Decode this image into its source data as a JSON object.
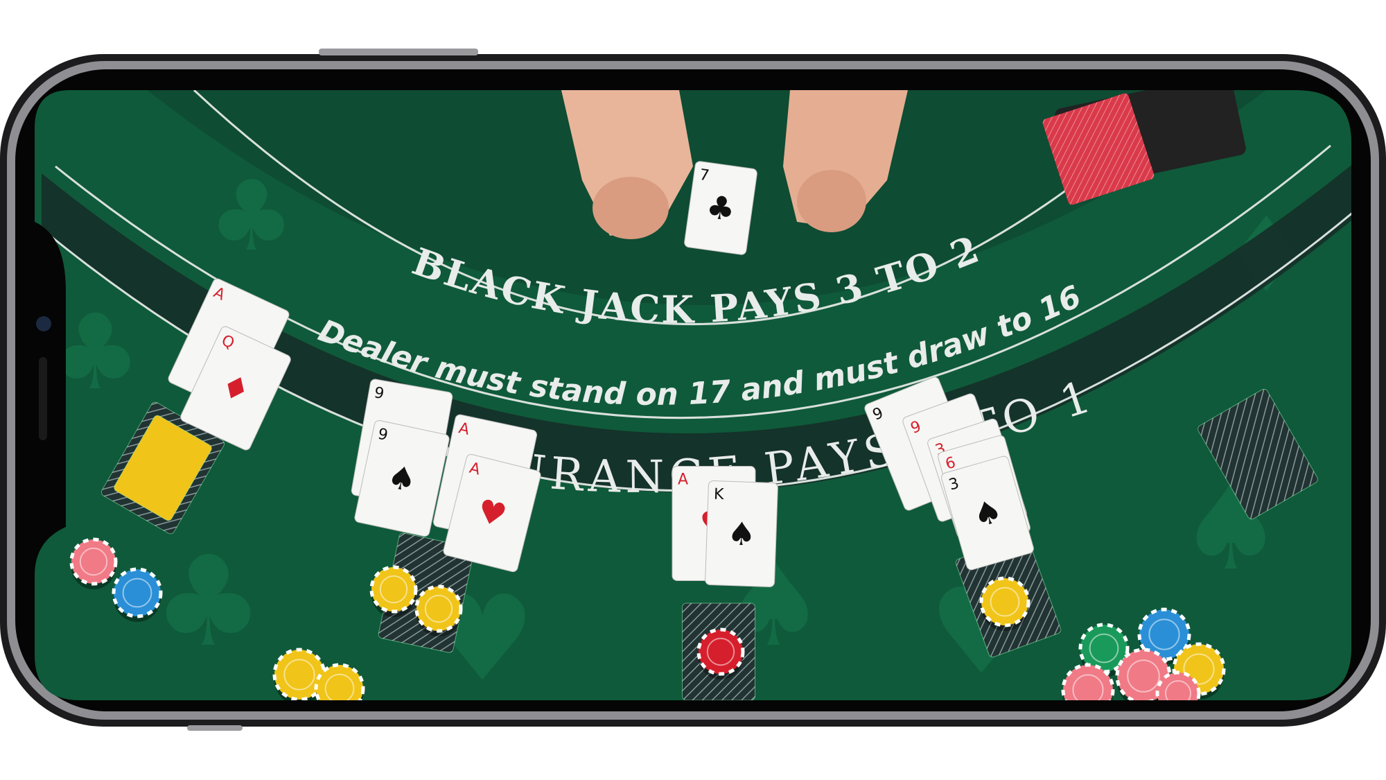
{
  "table": {
    "line1": "BLACK JACK PAYS 3 TO 2",
    "line2": "Dealer must stand on 17 and must draw to 16",
    "line3": "INSURANCE PAYS 2 TO 1"
  },
  "colors": {
    "felt": "#0f5a3a",
    "felt_dark": "#0b3f2a",
    "band": "#17302a",
    "text": "#e8ecea",
    "chip_yellow": "#f0c419",
    "chip_red": "#d61f2c",
    "chip_blue": "#2a8fd6",
    "chip_green": "#1a9a5a",
    "chip_pink": "#f07a86",
    "card_back_red": "#d93a4a"
  },
  "cards": [
    {
      "id": "player1-card1",
      "rank": "A",
      "suit": "♦",
      "color": "red"
    },
    {
      "id": "player1-card2",
      "rank": "Q",
      "suit": "♦",
      "color": "red"
    },
    {
      "id": "player2-card1",
      "rank": "9",
      "suit": "♣",
      "color": "black"
    },
    {
      "id": "player2-card2",
      "rank": "9",
      "suit": "♠",
      "color": "black"
    },
    {
      "id": "player3-card1",
      "rank": "A",
      "suit": "♥",
      "color": "red"
    },
    {
      "id": "player3-card2",
      "rank": "A",
      "suit": "♥",
      "color": "red"
    },
    {
      "id": "dealer-up-card",
      "rank": "A",
      "suit": "♥",
      "color": "red"
    },
    {
      "id": "dealer-hole-card",
      "rank": "K",
      "suit": "♠",
      "color": "black"
    },
    {
      "id": "player5-card1",
      "rank": "9",
      "suit": "♠",
      "color": "black"
    },
    {
      "id": "player5-card2",
      "rank": "9",
      "suit": "♥",
      "color": "red"
    },
    {
      "id": "player5-card3",
      "rank": "3",
      "suit": "♥",
      "color": "red"
    },
    {
      "id": "player5-card4",
      "rank": "6",
      "suit": "♥",
      "color": "red"
    },
    {
      "id": "player5-card5",
      "rank": "3",
      "suit": "♠",
      "color": "black"
    },
    {
      "id": "dealer-hand-card",
      "rank": "7",
      "suit": "♣",
      "color": "black"
    }
  ]
}
